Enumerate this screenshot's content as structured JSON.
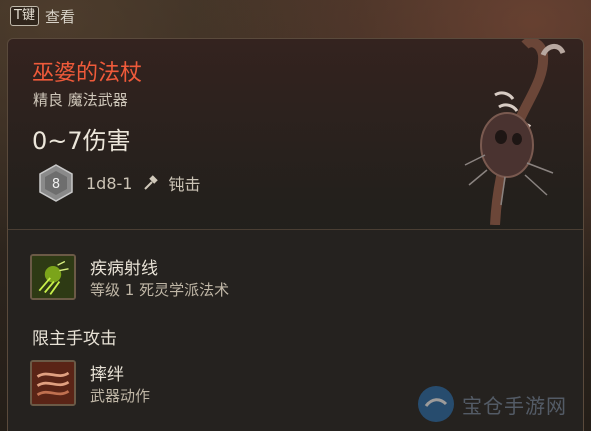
{
  "hint": {
    "key": "T键",
    "label": "查看"
  },
  "item": {
    "name": "巫婆的法杖",
    "rarity_type": "精良 魔法武器",
    "damage": "0~7伤害",
    "dice_face": "8",
    "dice_formula": "1d8-1",
    "damage_type": "钝击"
  },
  "abilities": {
    "spell": {
      "name": "疾病射线",
      "detail": "等级 1 死灵学派法术",
      "icon": "sickness-ray-icon"
    },
    "section_label": "限主手攻击",
    "action": {
      "name": "摔绊",
      "detail": "武器动作",
      "icon": "trip-icon"
    }
  },
  "watermark": {
    "text": "宝仓手游网"
  },
  "colors": {
    "title": "#ef5a3a",
    "text": "#ece6da",
    "muted": "#bfb6a6"
  }
}
